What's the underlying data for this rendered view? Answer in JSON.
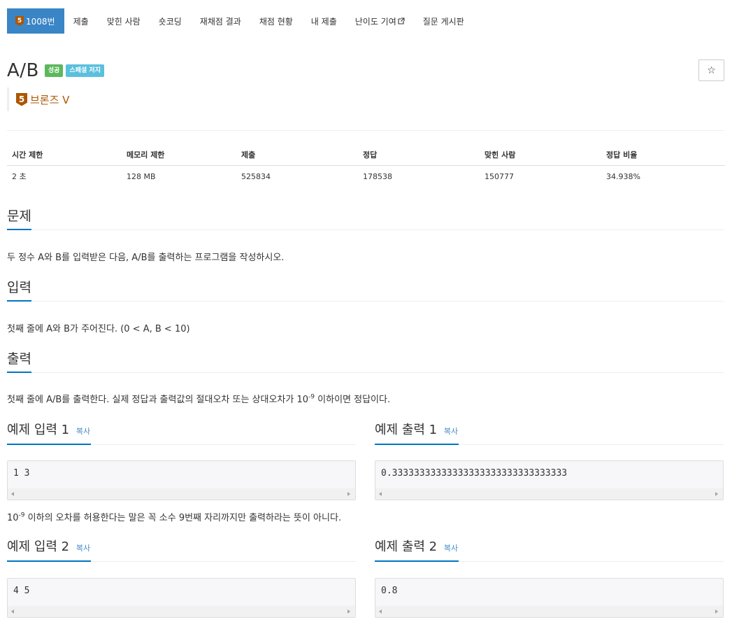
{
  "nav": {
    "problem_tab": "1008번",
    "tier_num": "5",
    "items": [
      "제출",
      "맞힌 사람",
      "숏코딩",
      "재채점 결과",
      "채점 현황",
      "내 제출",
      "난이도 기여",
      "질문 게시판"
    ]
  },
  "problem": {
    "title": "A/B",
    "labels": [
      "성공",
      "스페셜 저지"
    ],
    "tier_num": "5",
    "tier": "브론즈 V",
    "star_icon": "star-icon"
  },
  "info": {
    "headers": [
      "시간 제한",
      "메모리 제한",
      "제출",
      "정답",
      "맞힌 사람",
      "정답 비율"
    ],
    "values": [
      "2 초",
      "128 MB",
      "525834",
      "178538",
      "150777",
      "34.938%"
    ]
  },
  "sections": {
    "problem_title": "문제",
    "problem_text": "두 정수 A와 B를 입력받은 다음, A/B를 출력하는 프로그램을 작성하시오.",
    "input_title": "입력",
    "input_text": "첫째 줄에 A와 B가 주어진다. (0 < A, B < 10)",
    "output_title": "출력",
    "output_text_pre": "첫째 줄에 A/B를 출력한다. 실제 정답과 출력값의 절대오차 또는 상대오차가 10",
    "output_text_sup": "-9",
    "output_text_post": " 이하이면 정답이다."
  },
  "samples": {
    "copy_label": "복사",
    "in1_title": "예제 입력 1",
    "in1": "1 3",
    "out1_title": "예제 출력 1",
    "out1": "0.33333333333333333333333333333333",
    "note_pre": "10",
    "note_sup": "-9",
    "note_post": " 이하의 오차를 허용한다는 말은 꼭 소수 9번째 자리까지만 출력하라는 뜻이 아니다.",
    "in2_title": "예제 입력 2",
    "in2": "4 5",
    "out2_title": "예제 출력 2",
    "out2": "0.8"
  },
  "colors": {
    "nav_active": "#3a85c6",
    "bronze": "#ad5600",
    "success": "#5cb85c",
    "info": "#5bc0de",
    "accent_underline": "#0076c0",
    "link": "#428bca"
  }
}
